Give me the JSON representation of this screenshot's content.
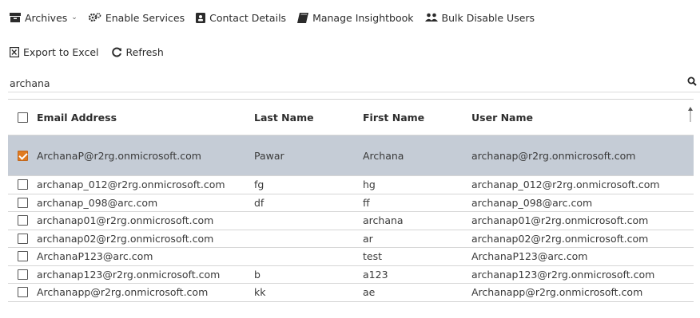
{
  "toolbar": {
    "archives_label": "Archives",
    "enable_services_label": "Enable Services",
    "contact_details_label": "Contact Details",
    "manage_insightbook_label": "Manage Insightbook",
    "bulk_disable_label": "Bulk Disable Users",
    "export_label": "Export to Excel",
    "refresh_label": "Refresh"
  },
  "search": {
    "value": "archana"
  },
  "table": {
    "columns": [
      "Email Address",
      "Last Name",
      "First Name",
      "User Name"
    ],
    "rows": [
      {
        "email": "ArchanaP@r2rg.onmicrosoft.com",
        "last": "Pawar",
        "first": "Archana",
        "user": "archanap@r2rg.onmicrosoft.com",
        "selected": true
      },
      {
        "email": "archanap_012@r2rg.onmicrosoft.com",
        "last": "fg",
        "first": "hg",
        "user": "archanap_012@r2rg.onmicrosoft.com",
        "selected": false
      },
      {
        "email": "archanap_098@arc.com",
        "last": "df",
        "first": "ff",
        "user": "archanap_098@arc.com",
        "selected": false
      },
      {
        "email": "archanap01@r2rg.onmicrosoft.com",
        "last": "",
        "first": "archana",
        "user": "archanap01@r2rg.onmicrosoft.com",
        "selected": false
      },
      {
        "email": "archanap02@r2rg.onmicrosoft.com",
        "last": "",
        "first": "ar",
        "user": "archanap02@r2rg.onmicrosoft.com",
        "selected": false
      },
      {
        "email": "ArchanaP123@arc.com",
        "last": "",
        "first": "test",
        "user": "ArchanaP123@arc.com",
        "selected": false
      },
      {
        "email": "archanap123@r2rg.onmicrosoft.com",
        "last": "b",
        "first": "a123",
        "user": "archanap123@r2rg.onmicrosoft.com",
        "selected": false
      },
      {
        "email": "Archanapp@r2rg.onmicrosoft.com",
        "last": "kk",
        "first": "ae",
        "user": "Archanapp@r2rg.onmicrosoft.com",
        "selected": false
      }
    ]
  },
  "colors": {
    "selected_row": "#c5ccd6",
    "checkbox_checked": "#e07b20"
  },
  "icons": [
    "archive-icon",
    "gear-icon",
    "contact-card-icon",
    "book-icon",
    "users-icon",
    "excel-icon",
    "refresh-icon",
    "search-icon"
  ]
}
